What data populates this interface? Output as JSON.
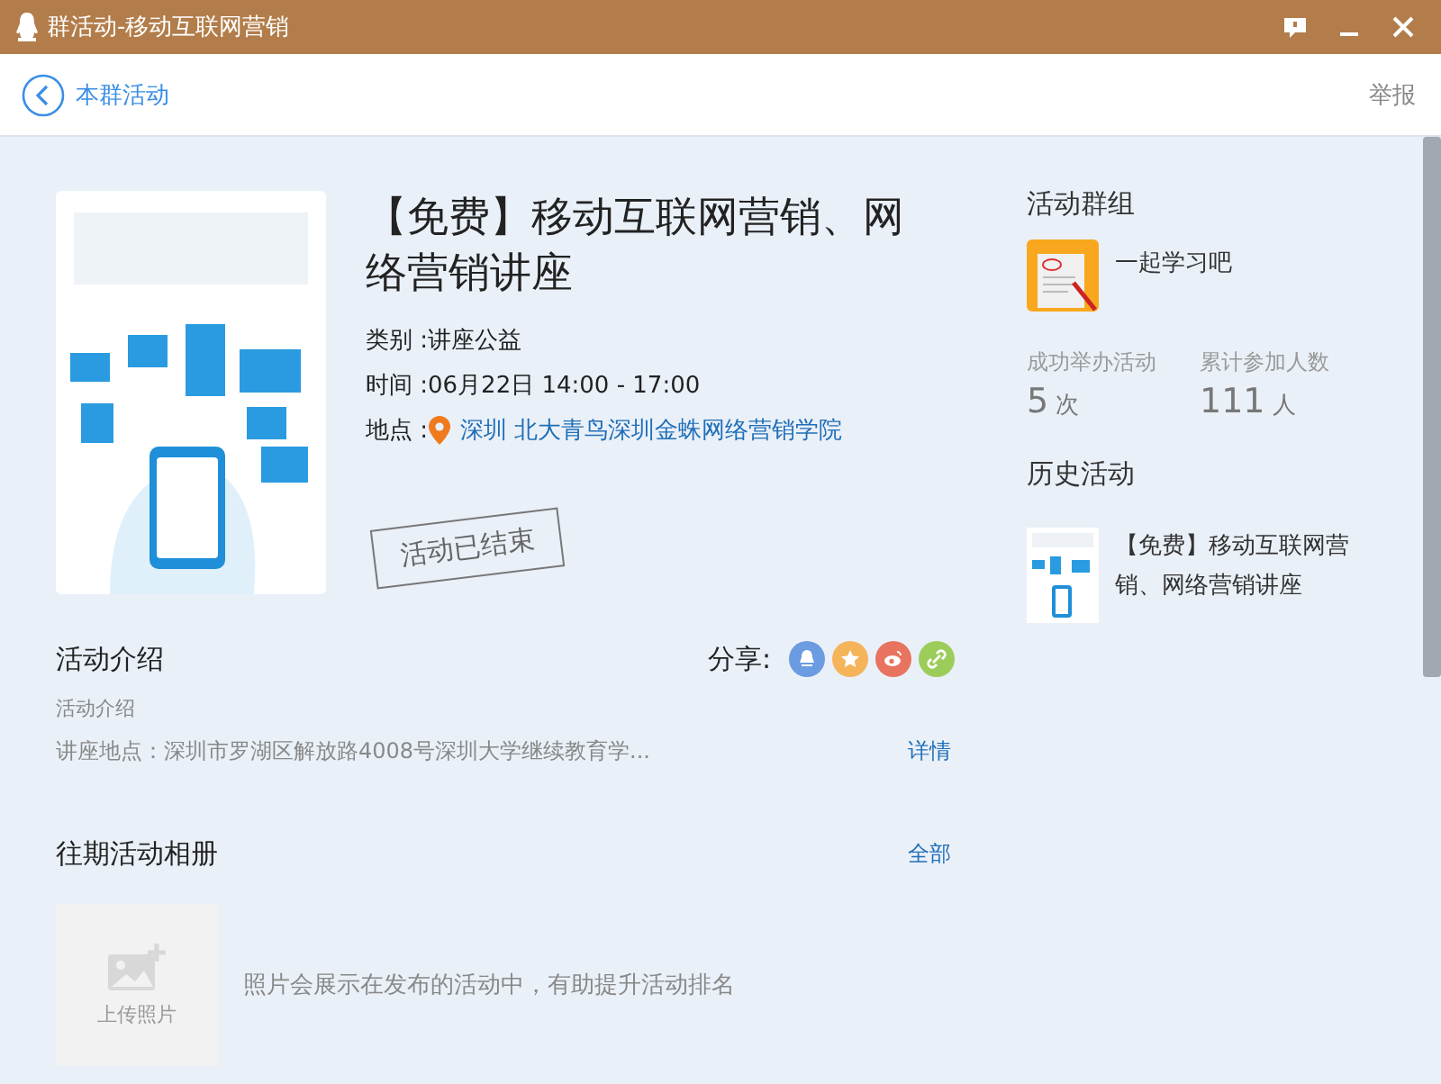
{
  "window": {
    "title": "群活动-移动互联网营销"
  },
  "nav": {
    "back": "本群活动",
    "report": "举报"
  },
  "event": {
    "title": "【免费】移动互联网营销、网络营销讲座",
    "details": [
      {
        "kind": "text",
        "label": "类别 : ",
        "value": "讲座公益"
      },
      {
        "kind": "text",
        "label": "时间 : ",
        "value": "06月22日 14:00 - 17:00"
      },
      {
        "kind": "location",
        "label": "地点 : ",
        "value": "深圳 北大青鸟深圳金蛛网络营销学院"
      }
    ],
    "status_stamp": "活动已结束"
  },
  "intro": {
    "heading": "活动介绍",
    "share_label": "分享:",
    "share": [
      {
        "kind": "qq",
        "color": "#6b9be0"
      },
      {
        "kind": "star",
        "color": "#f5b45a"
      },
      {
        "kind": "weibo",
        "color": "#e8735f"
      },
      {
        "kind": "link",
        "color": "#9ccc5a"
      }
    ],
    "subtitle": "活动介绍",
    "summary": "讲座地点：深圳市罗湖区解放路4008号深圳大学继续教育学...",
    "more": "详情"
  },
  "album": {
    "heading": "往期活动相册",
    "all": "全部",
    "upload": "上传照片",
    "hint": "照片会展示在发布的活动中，有助提升活动排名"
  },
  "group": {
    "heading": "活动群组",
    "name": "一起学习吧",
    "stats": [
      {
        "label": "成功举办活动",
        "value": "5",
        "unit": "次"
      },
      {
        "label": "累计参加人数",
        "value": "111",
        "unit": "人"
      }
    ]
  },
  "history": {
    "heading": "历史活动",
    "items": [
      {
        "title": "【免费】移动互联网营销、网络营销讲座"
      }
    ]
  }
}
